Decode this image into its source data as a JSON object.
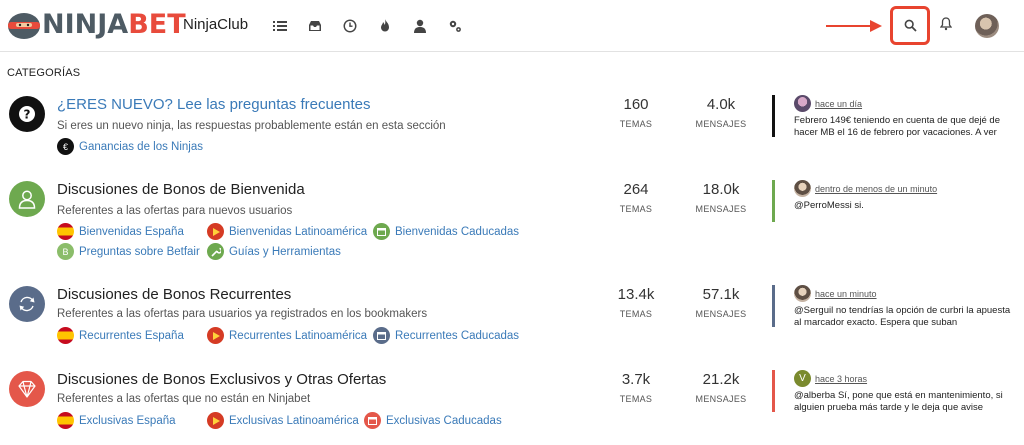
{
  "header": {
    "logo_part1": "NINJA",
    "logo_part2": "BET",
    "club_label": "NinjaClub",
    "nav_icons": [
      "list-icon",
      "inbox-icon",
      "clock-icon",
      "fire-icon",
      "user-icon",
      "gears-icon"
    ],
    "accent": "#e8442f"
  },
  "categories_title": "CATEGORÍAS",
  "categories": [
    {
      "name": "¿ERES NUEVO? Lee las preguntas frecuentes",
      "description": "Si eres un nuevo ninja, las respuestas probablemente están en esta sección",
      "icon": "question-icon",
      "color": "#111111",
      "subcategories": [
        {
          "label": "Ganancias de los Ninjas",
          "icon": "euro-icon"
        }
      ],
      "topics": "160",
      "topics_label": "TEMAS",
      "posts": "4.0k",
      "posts_label": "MENSAJES",
      "last_post": {
        "time": "hace un día",
        "text": "Febrero 149€ teniendo en cuenta de que dejé de hacer MB el 16 de febrero por vacaciones. A ver"
      }
    },
    {
      "name": "Discusiones de Bonos de Bienvenida",
      "description": "Referentes a las ofertas para nuevos usuarios",
      "icon": "user-outline-icon",
      "color": "#6ea94f",
      "subcategories": [
        {
          "label": "Bienvenidas España",
          "icon": "spain-flag-icon"
        },
        {
          "label": "Bienvenidas Latinoamérica",
          "icon": "play-icon"
        },
        {
          "label": "Bienvenidas Caducadas",
          "icon": "calendar-icon"
        },
        {
          "label": "Preguntas sobre Betfair",
          "icon": "b-letter-icon"
        },
        {
          "label": "Guías y Herramientas",
          "icon": "wrench-icon"
        }
      ],
      "topics": "264",
      "topics_label": "TEMAS",
      "posts": "18.0k",
      "posts_label": "MENSAJES",
      "last_post": {
        "time": "dentro de menos de un minuto",
        "text": "@PerroMessi si."
      }
    },
    {
      "name": "Discusiones de Bonos Recurrentes",
      "description": "Referentes a las ofertas para usuarios ya registrados en los bookmakers",
      "icon": "refresh-icon",
      "color": "#5a6c8a",
      "subcategories": [
        {
          "label": "Recurrentes España",
          "icon": "spain-flag-icon"
        },
        {
          "label": "Recurrentes Latinoamérica",
          "icon": "play-icon"
        },
        {
          "label": "Recurrentes Caducadas",
          "icon": "calendar-icon"
        }
      ],
      "topics": "13.4k",
      "topics_label": "TEMAS",
      "posts": "57.1k",
      "posts_label": "MENSAJES",
      "last_post": {
        "time": "hace un minuto",
        "text": "@Serguil no tendrías la opción de curbri la apuesta al marcador exacto. Espera que suban"
      }
    },
    {
      "name": "Discusiones de Bonos Exclusivos y Otras Ofertas",
      "description": "Referentes a las ofertas que no están en Ninjabet",
      "icon": "diamond-icon",
      "color": "#e4574a",
      "subcategories": [
        {
          "label": "Exclusivas España",
          "icon": "spain-flag-icon"
        },
        {
          "label": "Exclusivas Latinoamérica",
          "icon": "play-icon"
        },
        {
          "label": "Exclusivas Caducadas",
          "icon": "calendar-icon"
        }
      ],
      "topics": "3.7k",
      "topics_label": "TEMAS",
      "posts": "21.2k",
      "posts_label": "MENSAJES",
      "last_post": {
        "avatar_letter": "V",
        "time": "hace 3 horas",
        "text": "@alberba Sí, pone que está en mantenimiento, si alguien prueba más tarde y le deja que avise"
      }
    }
  ]
}
